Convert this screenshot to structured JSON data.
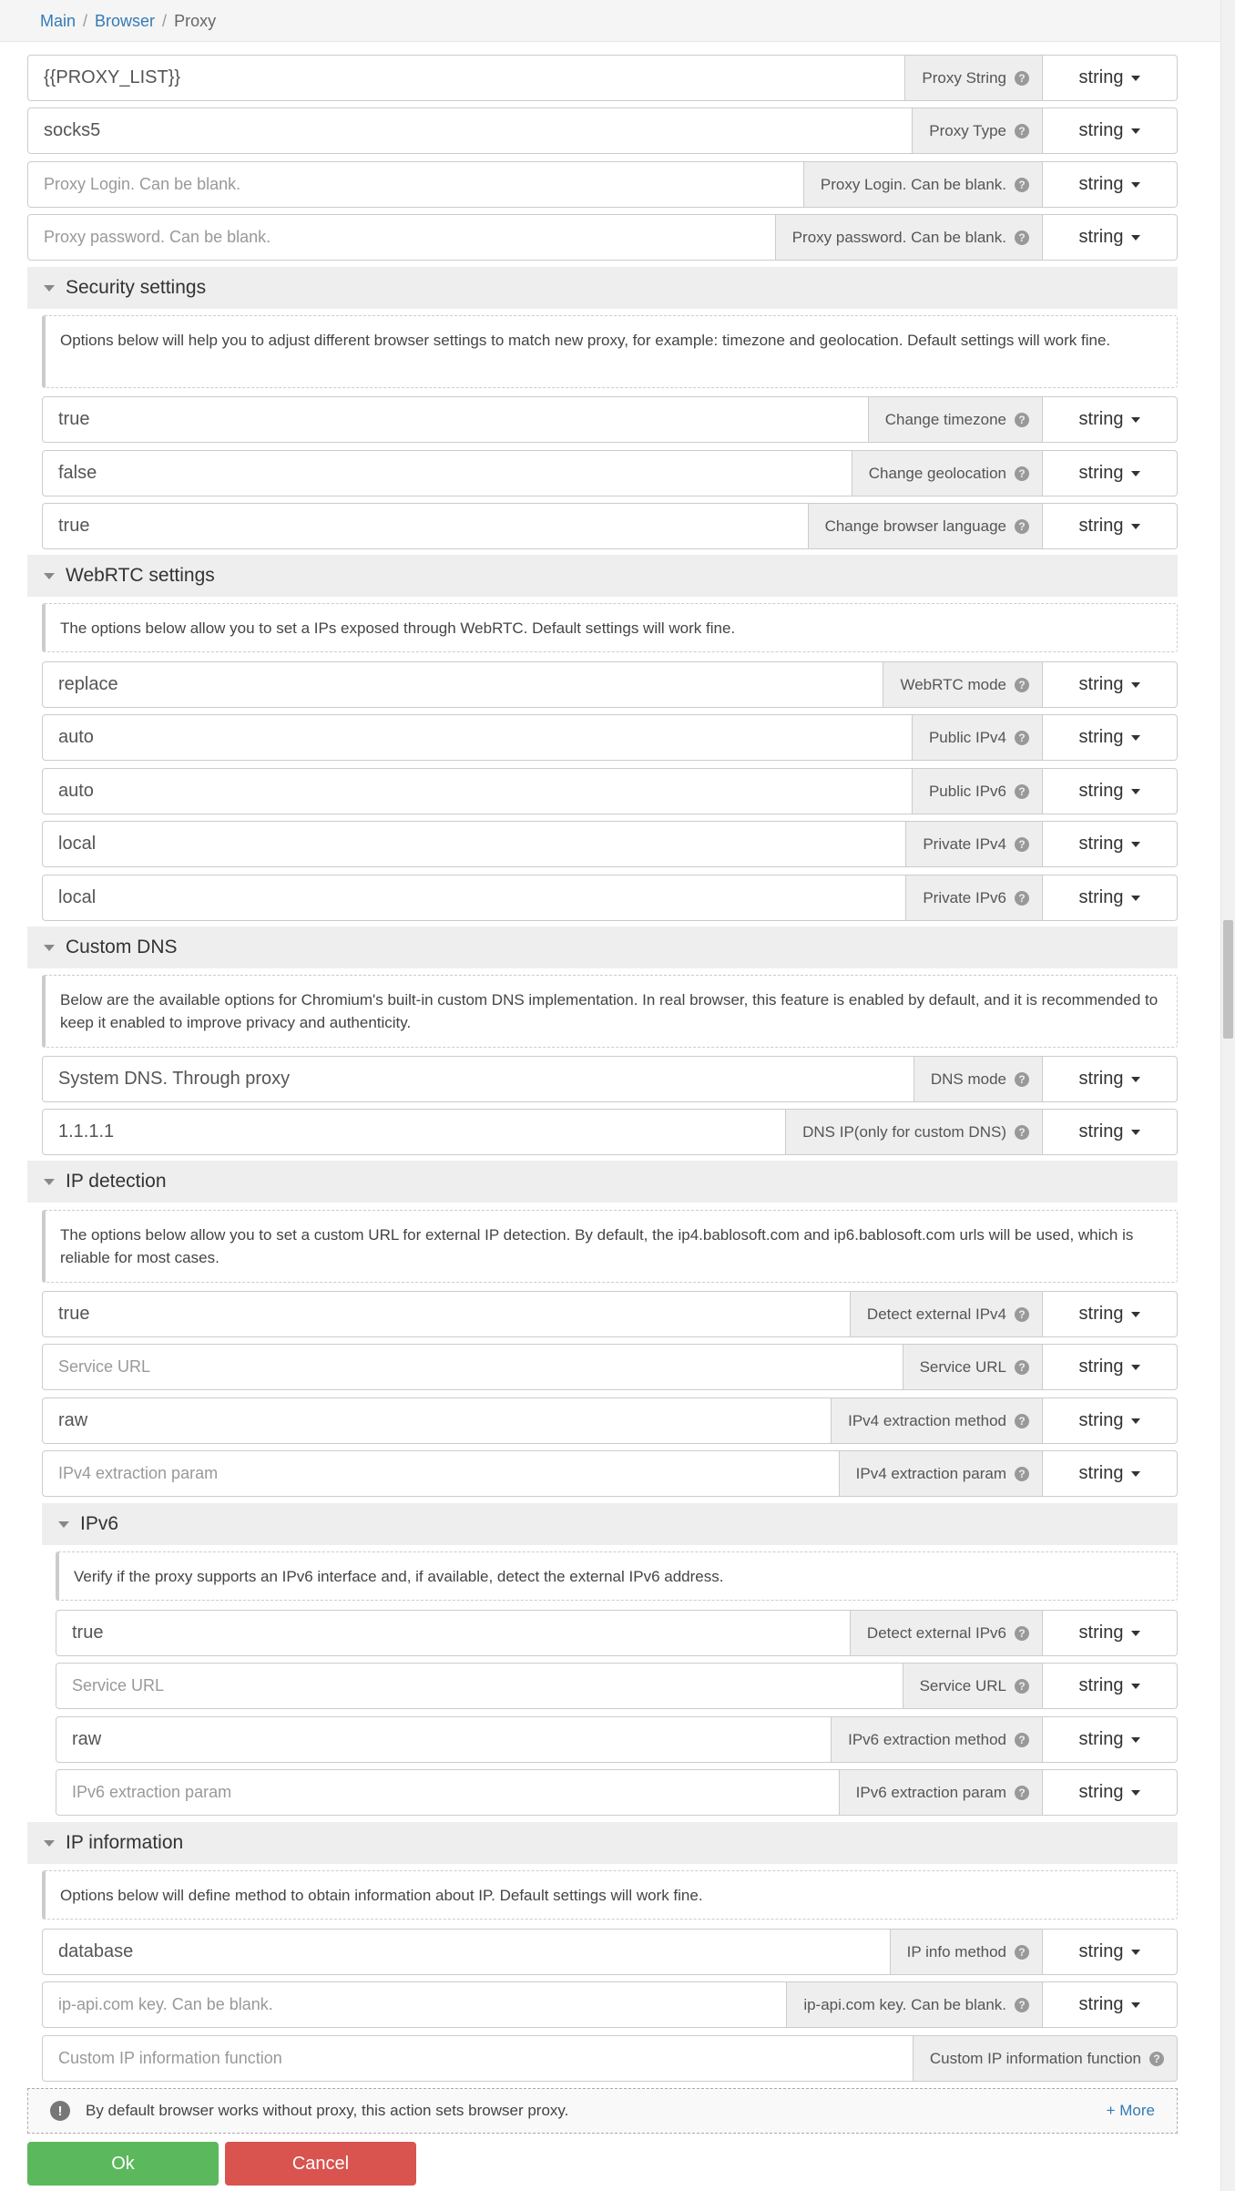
{
  "breadcrumb": {
    "main": "Main",
    "browser": "Browser",
    "current": "Proxy"
  },
  "type_label": "string",
  "help_icon": "?",
  "rows": {
    "proxy_string": {
      "value": "{{PROXY_LIST}}",
      "label": "Proxy String"
    },
    "proxy_type": {
      "value": "socks5",
      "label": "Proxy Type"
    },
    "proxy_login": {
      "placeholder": "Proxy Login. Can be blank.",
      "label": "Proxy Login. Can be blank."
    },
    "proxy_password": {
      "placeholder": "Proxy password. Can be blank.",
      "label": "Proxy password. Can be blank."
    },
    "change_timezone": {
      "value": "true",
      "label": "Change timezone"
    },
    "change_geolocation": {
      "value": "false",
      "label": "Change geolocation"
    },
    "change_language": {
      "value": "true",
      "label": "Change browser language"
    },
    "webrtc_mode": {
      "value": "replace",
      "label": "WebRTC mode"
    },
    "public_ipv4": {
      "value": "auto",
      "label": "Public IPv4"
    },
    "public_ipv6": {
      "value": "auto",
      "label": "Public IPv6"
    },
    "private_ipv4": {
      "value": "local",
      "label": "Private IPv4"
    },
    "private_ipv6": {
      "value": "local",
      "label": "Private IPv6"
    },
    "dns_mode": {
      "value": "System DNS. Through proxy",
      "label": "DNS mode"
    },
    "dns_ip": {
      "value": "1.1.1.1",
      "label": "DNS IP(only for custom DNS)"
    },
    "detect_ipv4": {
      "value": "true",
      "label": "Detect external IPv4"
    },
    "service_url_v4": {
      "placeholder": "Service URL",
      "label": "Service URL"
    },
    "ipv4_method": {
      "value": "raw",
      "label": "IPv4 extraction method"
    },
    "ipv4_param": {
      "placeholder": "IPv4 extraction param",
      "label": "IPv4 extraction param"
    },
    "detect_ipv6": {
      "value": "true",
      "label": "Detect external IPv6"
    },
    "service_url_v6": {
      "placeholder": "Service URL",
      "label": "Service URL"
    },
    "ipv6_method": {
      "value": "raw",
      "label": "IPv6 extraction method"
    },
    "ipv6_param": {
      "placeholder": "IPv6 extraction param",
      "label": "IPv6 extraction param"
    },
    "ip_info_method": {
      "value": "database",
      "label": "IP info method"
    },
    "ipapi_key": {
      "placeholder": "ip-api.com key. Can be blank.",
      "label": "ip-api.com key. Can be blank."
    },
    "custom_ip_function": {
      "placeholder": "Custom IP information function",
      "label": "Custom IP information function"
    }
  },
  "sections": {
    "security": {
      "title": "Security settings",
      "info": "Options below will help you to adjust different browser settings to match new proxy, for example: timezone and geolocation. Default settings will work fine."
    },
    "webrtc": {
      "title": "WebRTC settings",
      "info": "The options below allow you to set a IPs exposed through WebRTC. Default settings will work fine."
    },
    "dns": {
      "title": "Custom DNS",
      "info": "Below are the available options for Chromium's built-in custom DNS implementation. In real browser, this feature is enabled by default, and it is recommended to keep it enabled to improve privacy and authenticity."
    },
    "ipdetect": {
      "title": "IP detection",
      "info": "The options below allow you to set a custom URL for external IP detection. By default, the ip4.bablosoft.com and ip6.bablosoft.com urls will be used, which is reliable for most cases."
    },
    "ipv6": {
      "title": "IPv6",
      "info": "Verify if the proxy supports an IPv6 interface and, if available, detect the external IPv6 address."
    },
    "ipinfo": {
      "title": "IP information",
      "info": "Options below will define method to obtain information about IP. Default settings will work fine."
    }
  },
  "footer": {
    "note": "By default browser works without proxy, this action sets browser proxy.",
    "more": "+ More",
    "icon": "!"
  },
  "buttons": {
    "ok": "Ok",
    "cancel": "Cancel"
  }
}
